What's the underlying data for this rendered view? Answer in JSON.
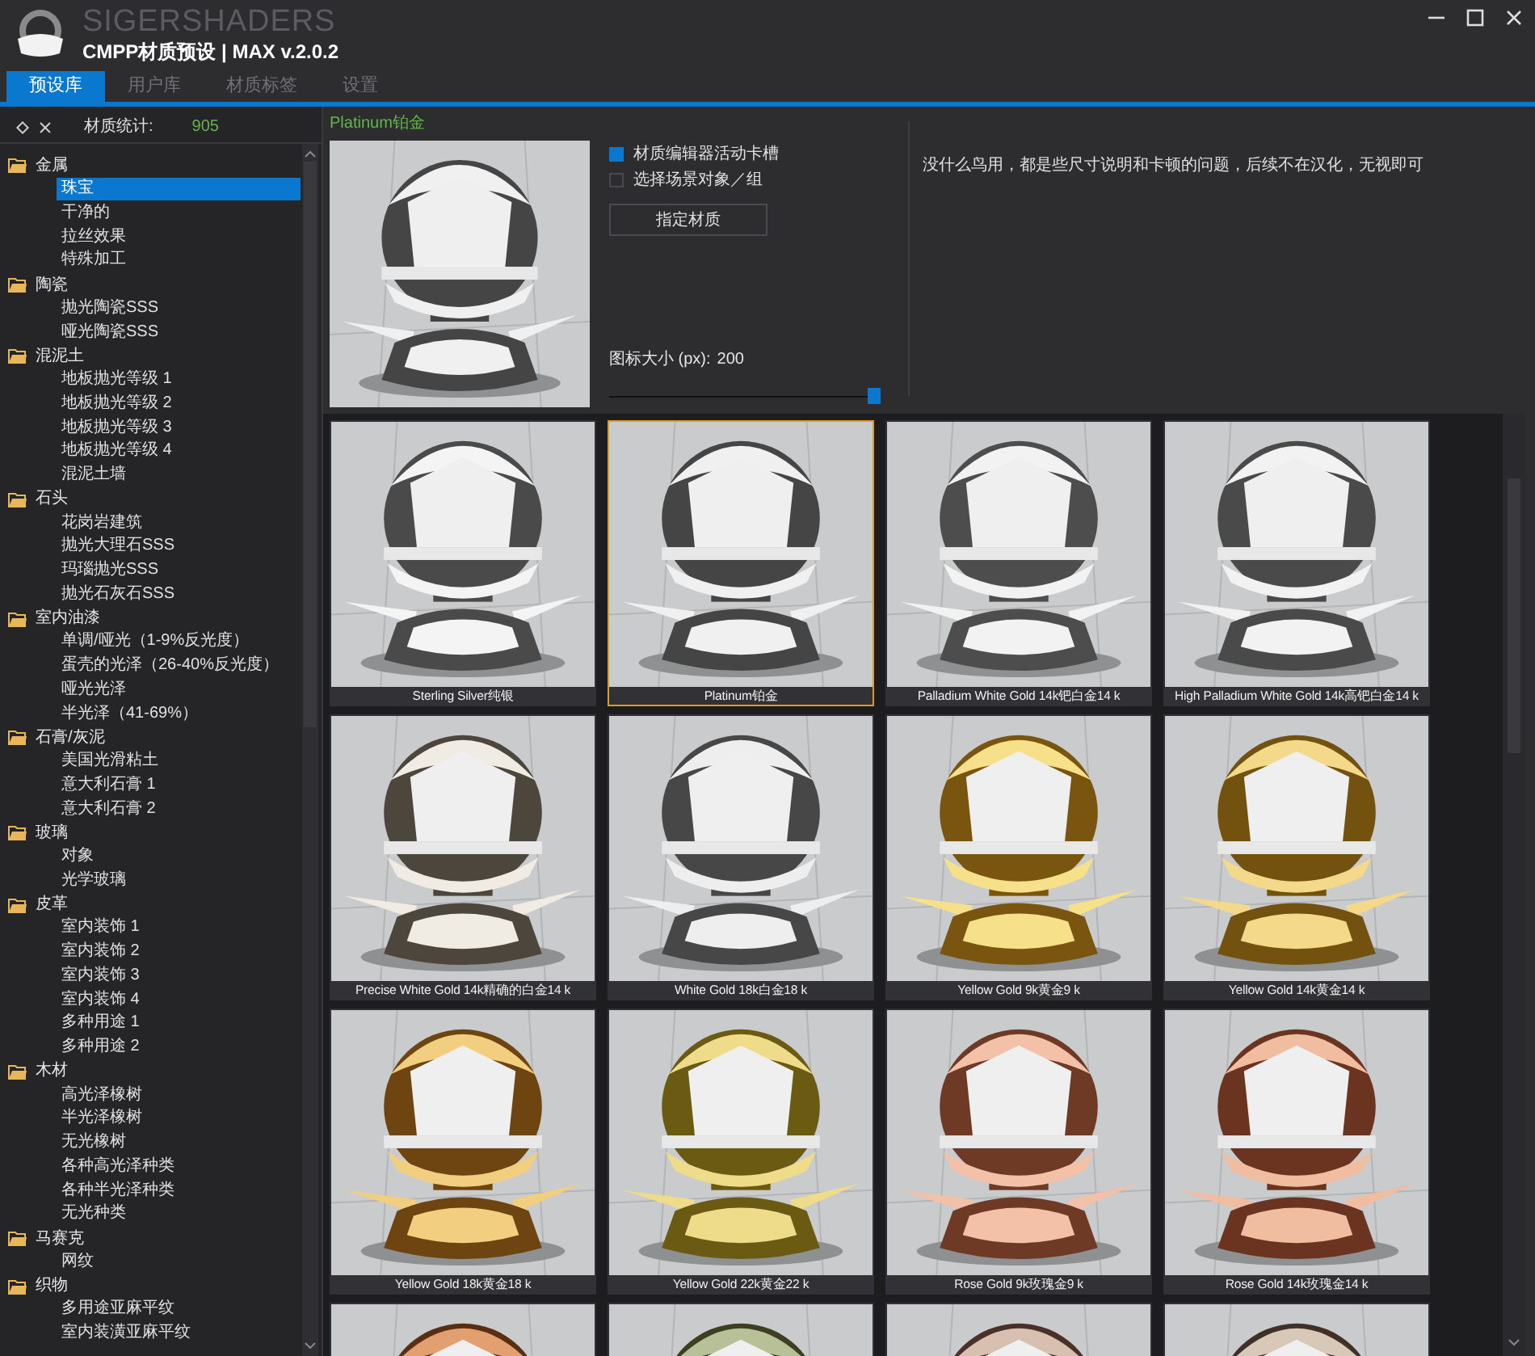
{
  "header": {
    "brand": "SIGERSHADERS",
    "title": "CMPP材质预设 | MAX v.2.0.2"
  },
  "tabs": [
    {
      "label": "预设库",
      "selected": true
    },
    {
      "label": "用户库",
      "selected": false
    },
    {
      "label": "材质标签",
      "selected": false
    },
    {
      "label": "设置",
      "selected": false
    }
  ],
  "library": {
    "stats_label": "材质统计:",
    "stats_value": "905",
    "tree": [
      {
        "label": "金属",
        "children": [
          {
            "label": "珠宝",
            "selected": true
          },
          {
            "label": "干净的",
            "selected": false
          },
          {
            "label": "拉丝效果",
            "selected": false
          },
          {
            "label": "特殊加工",
            "selected": false
          }
        ]
      },
      {
        "label": "陶瓷",
        "children": [
          {
            "label": "抛光陶瓷SSS",
            "selected": false
          },
          {
            "label": "哑光陶瓷SSS",
            "selected": false
          }
        ]
      },
      {
        "label": "混泥土",
        "children": [
          {
            "label": "地板抛光等级 1",
            "selected": false
          },
          {
            "label": "地板抛光等级 2",
            "selected": false
          },
          {
            "label": "地板抛光等级 3",
            "selected": false
          },
          {
            "label": "地板抛光等级 4",
            "selected": false
          },
          {
            "label": "混泥土墙",
            "selected": false
          }
        ]
      },
      {
        "label": "石头",
        "children": [
          {
            "label": "花岗岩建筑",
            "selected": false
          },
          {
            "label": "抛光大理石SSS",
            "selected": false
          },
          {
            "label": "玛瑙抛光SSS",
            "selected": false
          },
          {
            "label": "抛光石灰石SSS",
            "selected": false
          }
        ]
      },
      {
        "label": "室内油漆",
        "children": [
          {
            "label": "单调/哑光（1-9%反光度）",
            "selected": false
          },
          {
            "label": "蛋壳的光泽（26-40%反光度）",
            "selected": false
          },
          {
            "label": "哑光光泽",
            "selected": false
          },
          {
            "label": "半光泽（41-69%）",
            "selected": false
          }
        ]
      },
      {
        "label": "石膏/灰泥",
        "children": [
          {
            "label": "美国光滑粘土",
            "selected": false
          },
          {
            "label": "意大利石膏 1",
            "selected": false
          },
          {
            "label": "意大利石膏 2",
            "selected": false
          }
        ]
      },
      {
        "label": "玻璃",
        "children": [
          {
            "label": "对象",
            "selected": false
          },
          {
            "label": "光学玻璃",
            "selected": false
          }
        ]
      },
      {
        "label": "皮革",
        "children": [
          {
            "label": "室内装饰 1",
            "selected": false
          },
          {
            "label": "室内装饰 2",
            "selected": false
          },
          {
            "label": "室内装饰 3",
            "selected": false
          },
          {
            "label": "室内装饰 4",
            "selected": false
          },
          {
            "label": "多种用途 1",
            "selected": false
          },
          {
            "label": "多种用途 2",
            "selected": false
          }
        ]
      },
      {
        "label": "木材",
        "children": [
          {
            "label": "高光泽橡树",
            "selected": false
          },
          {
            "label": "半光泽橡树",
            "selected": false
          },
          {
            "label": "无光橡树",
            "selected": false
          },
          {
            "label": "各种高光泽种类",
            "selected": false
          },
          {
            "label": "各种半光泽种类",
            "selected": false
          },
          {
            "label": "无光种类",
            "selected": false
          }
        ]
      },
      {
        "label": "马赛克",
        "children": [
          {
            "label": "网纹",
            "selected": false
          }
        ]
      },
      {
        "label": "织物",
        "children": [
          {
            "label": "多用途亚麻平纹",
            "selected": false
          },
          {
            "label": "室内装潢亚麻平纹",
            "selected": false
          }
        ]
      }
    ]
  },
  "material": {
    "name": "Platinum铂金",
    "options": [
      {
        "label": "材质编辑器活动卡槽",
        "checked": true
      },
      {
        "label": "选择场景对象／组",
        "checked": false
      }
    ],
    "assign_button": "指定材质",
    "icon_size_label": "图标大小 (px):",
    "icon_size_value": "200",
    "icon_size_slider": {
      "level": 1
    },
    "note": "没什么鸟用，都是些尺寸说明和卡顿的问题，后续不在汉化，无视即可"
  },
  "tiles": [
    {
      "caption": "Sterling Silver纯银",
      "selected": false
    },
    {
      "caption": "Platinum铂金",
      "selected": true
    },
    {
      "caption": "Palladium White Gold 14k钯白金14 k",
      "selected": false
    },
    {
      "caption": "High Palladium White Gold 14k高钯白金14 k",
      "selected": false
    },
    {
      "caption": "Precise White Gold 14k精确的白金14 k",
      "selected": false
    },
    {
      "caption": "White Gold 18k白金18 k",
      "selected": false
    },
    {
      "caption": "Yellow Gold 9k黄金9 k",
      "selected": false
    },
    {
      "caption": "Yellow Gold 14k黄金14 k",
      "selected": false
    },
    {
      "caption": "Yellow Gold 18k黄金18 k",
      "selected": false
    },
    {
      "caption": "Yellow Gold 22k黄金22 k",
      "selected": false
    },
    {
      "caption": "Rose Gold 9k玫瑰金9 k",
      "selected": false
    },
    {
      "caption": "Rose Gold 14k玫瑰金14 k",
      "selected": false
    },
    {
      "selected": false
    },
    {
      "selected": false
    },
    {
      "selected": false
    },
    {
      "selected": false
    }
  ]
}
